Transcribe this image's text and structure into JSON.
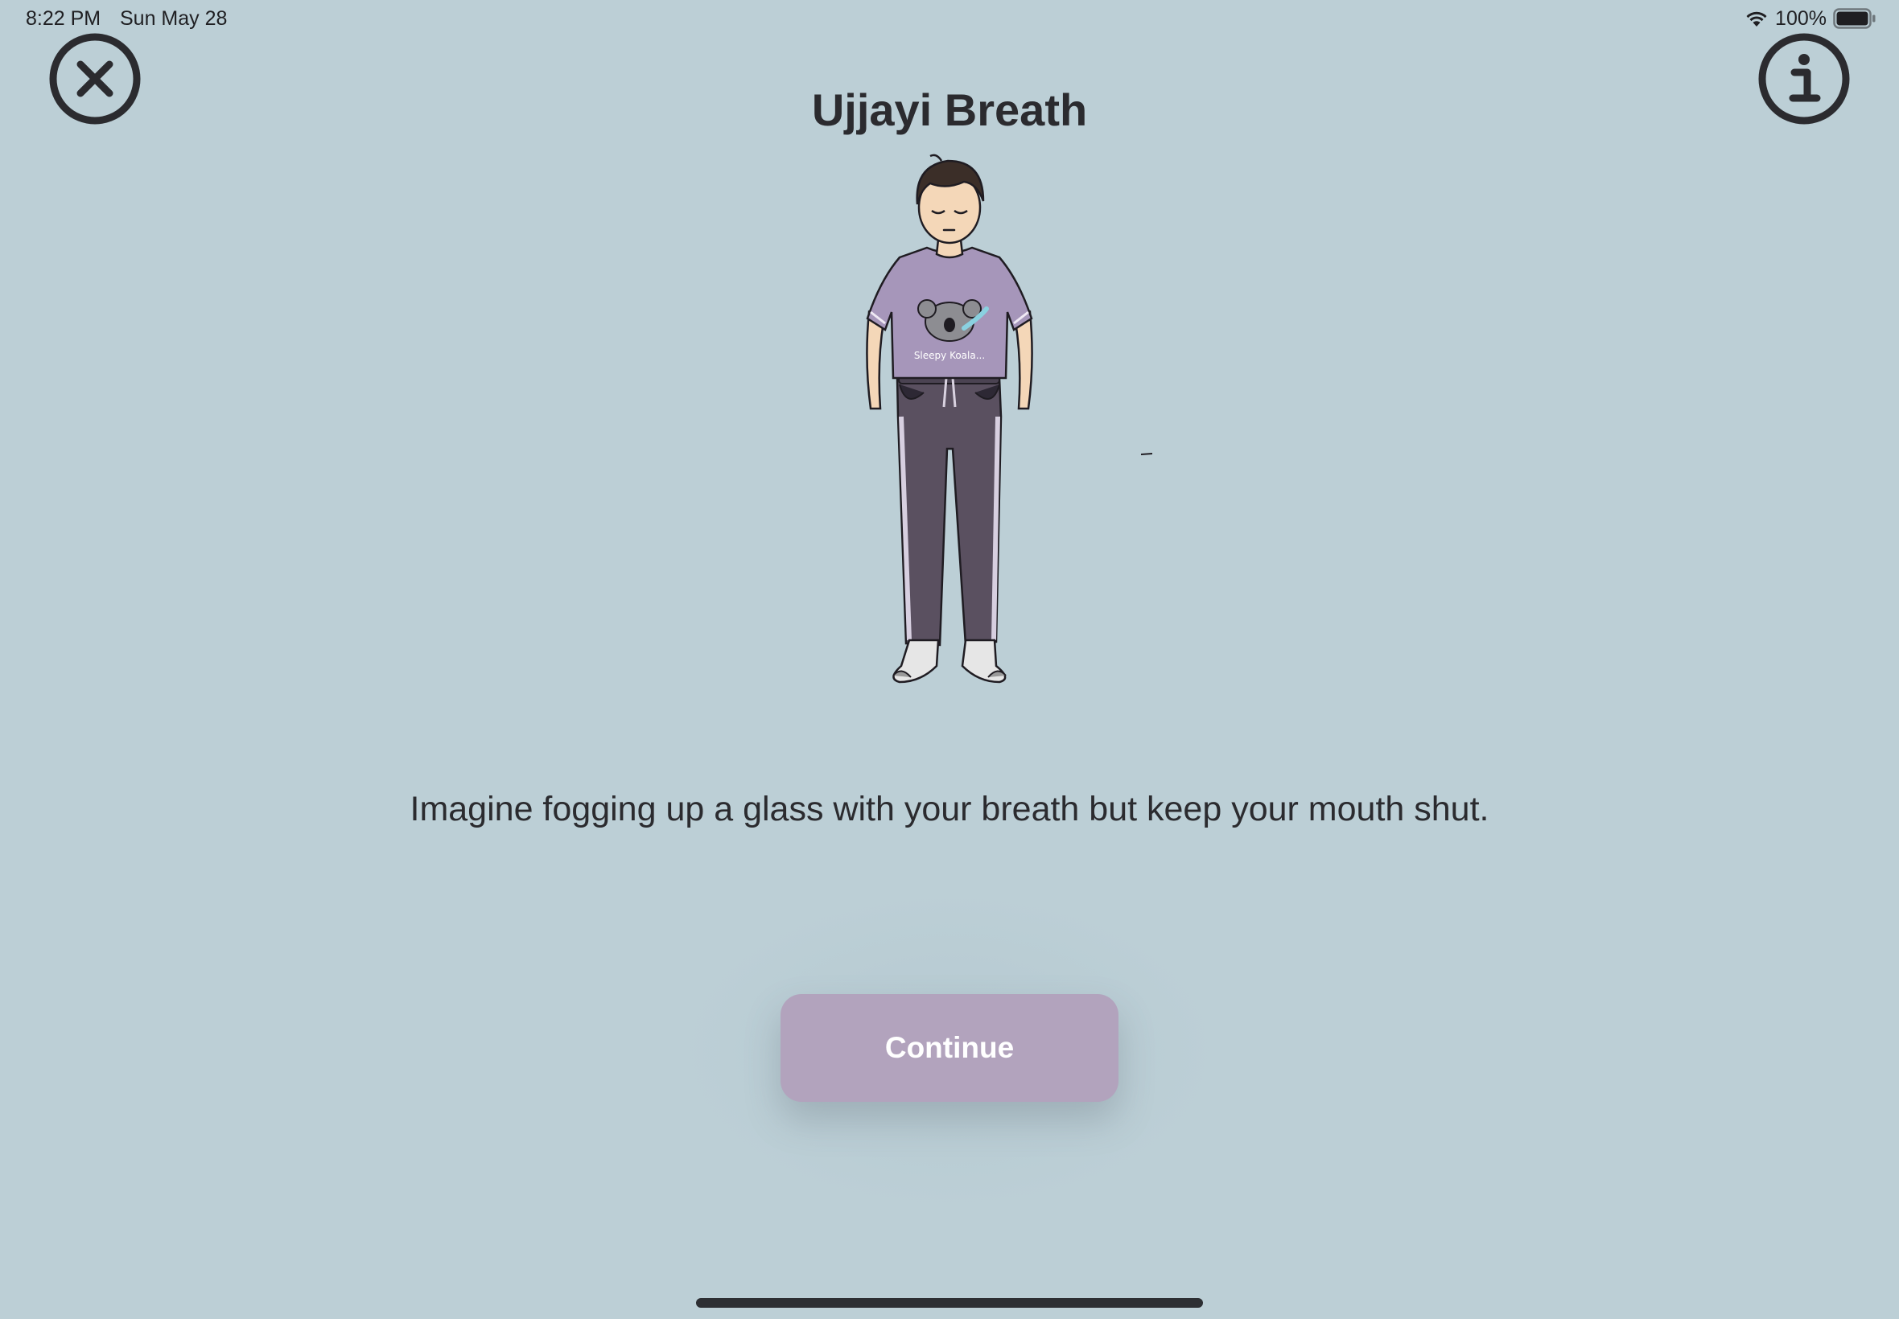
{
  "status_bar": {
    "time": "8:22 PM",
    "date": "Sun May 28",
    "battery": "100%",
    "icons": [
      "wifi-icon",
      "battery-icon"
    ]
  },
  "toolbar": {
    "close_icon": "close-icon",
    "info_icon": "info-icon"
  },
  "title": "Ujjayi Breath",
  "illustration": {
    "shirt_text": "Sleepy Koala..."
  },
  "instruction": "Imagine fogging up a glass with your breath but keep your mouth shut.",
  "continue_label": "Continue",
  "colors": {
    "background": "#bccfd6",
    "button": "#b2a3bd",
    "shirt": "#a696ba",
    "pants": "#5a5060",
    "text": "#2b2b2f"
  }
}
